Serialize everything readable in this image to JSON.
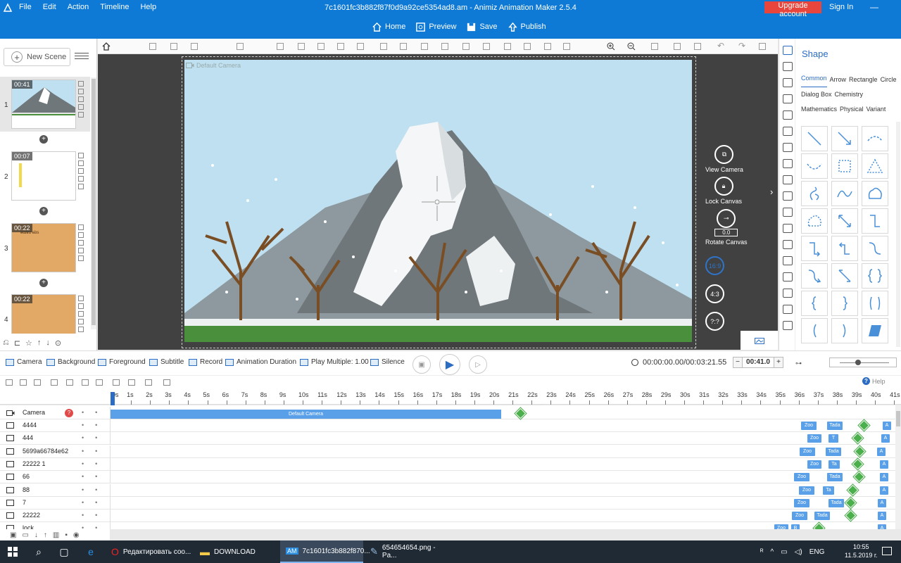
{
  "menu": [
    "File",
    "Edit",
    "Action",
    "Timeline",
    "Help"
  ],
  "window_title": "7c1601fc3b882f87f0d9a92ce5354ad8.am - Animiz Animation Maker 2.5.4",
  "upgrade_label": "Upgrade account",
  "signin_label": "Sign In",
  "nav": {
    "home": "Home",
    "preview": "Preview",
    "save": "Save",
    "publish": "Publish"
  },
  "new_scene_label": "New Scene",
  "scenes": [
    {
      "num": "1",
      "time": "00:41"
    },
    {
      "num": "2",
      "time": "00:07"
    },
    {
      "num": "3",
      "time": "00:22",
      "thumb_text": "ǝɯɐu ǝʇıs"
    },
    {
      "num": "4",
      "time": "00:22"
    }
  ],
  "camera_label": "Default Camera",
  "right_controls": {
    "view_camera": "View Camera",
    "lock_canvas": "Lock Canvas",
    "rotate_canvas": "Rotate Canvas",
    "rotate_value": "0.0",
    "ratio1": "16:9",
    "ratio2": "4:3",
    "ratio3": "?:?"
  },
  "shape_panel": {
    "title": "Shape",
    "tabs": [
      "Common",
      "Arrow",
      "Rectangle",
      "Circle",
      "Dialog Box",
      "Chemistry",
      "Mathematics",
      "Physical",
      "Variant"
    ],
    "active_tab": "Common"
  },
  "midbar": {
    "camera": "Camera",
    "background": "Background",
    "foreground": "Foreground",
    "subtitle": "Subtitle",
    "record": "Record",
    "anim_duration": "Animation Duration",
    "play_multiple": "Play Multiple: 1.00",
    "silence": "Silence",
    "time": "00:00:00.00/00:03:21.55",
    "duration": "00:41.0"
  },
  "help_label": "Help",
  "ruler": [
    "0s",
    "1s",
    "2s",
    "3s",
    "4s",
    "5s",
    "6s",
    "7s",
    "8s",
    "9s",
    "10s",
    "11s",
    "12s",
    "13s",
    "14s",
    "15s",
    "16s",
    "17s",
    "18s",
    "19s",
    "20s",
    "21s",
    "22s",
    "23s",
    "24s",
    "25s",
    "26s",
    "27s",
    "28s",
    "29s",
    "30s",
    "31s",
    "32s",
    "33s",
    "34s",
    "35s",
    "36s",
    "37s",
    "38s",
    "39s",
    "40s",
    "41s"
  ],
  "camera_track": {
    "name": "Camera",
    "qmark": "?",
    "bar_label": "Default Camera"
  },
  "tracks": [
    {
      "name": "4444",
      "e1": "Zoo",
      "e2": "Tada",
      "e3": "A"
    },
    {
      "name": "444",
      "e1": "Zoo",
      "e2": "T",
      "e3": "A"
    },
    {
      "name": "5699a66784e62",
      "e1": "Zoo",
      "e2": "Tada",
      "e3": "A"
    },
    {
      "name": "22222 1",
      "e1": "Zoo",
      "e2": "Ta",
      "e3": "A"
    },
    {
      "name": "66",
      "e1": "Zoo",
      "e2": "Tada",
      "e3": "A"
    },
    {
      "name": "88",
      "e1": "Zoo",
      "e2": "Ta",
      "e3": "A"
    },
    {
      "name": "7",
      "e1": "Zoo",
      "e2": "Tada",
      "e3": "A"
    },
    {
      "name": "22222",
      "e1": "Zoo",
      "e2": "Tada",
      "e3": "A"
    },
    {
      "name": "lock",
      "e1": "Zoo",
      "e2": "B",
      "e3": "A"
    }
  ],
  "taskbar": {
    "items": [
      "Редактировать соо...",
      "DOWNLOAD",
      "7c1601fc3b882f870...",
      "654654654.png - Pa..."
    ],
    "am_badge": "AM",
    "lang": "ENG",
    "time": "10:55",
    "date": "11.5.2019 г."
  },
  "colors": {
    "accent": "#0e7ad6",
    "upgrade": "#e8453c",
    "sky": "#bfe0f1",
    "grass": "#4a8f3c"
  }
}
